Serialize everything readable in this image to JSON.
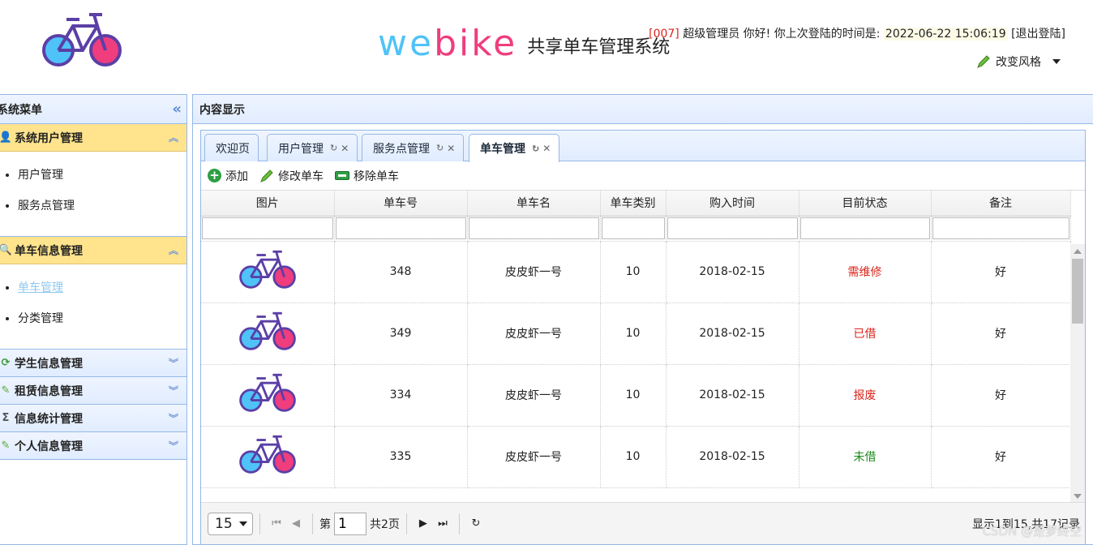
{
  "header": {
    "brand_we": "we",
    "brand_bike": "bike",
    "brand_sub": "共享单车管理系统",
    "user_id": "[007]",
    "user_text": " 超级管理员 你好! 你上次登陆的时间是: ",
    "last_login": "2022-06-22 15:06:19",
    "logout": "[退出登陆]",
    "change_style": "改变风格"
  },
  "sidebar": {
    "title": "系统菜单",
    "groups": [
      {
        "label": "系统用户管理",
        "icon": "user-icon",
        "items": [
          "用户管理",
          "服务点管理"
        ]
      },
      {
        "label": "单车信息管理",
        "icon": "search-icon",
        "items": [
          "单车管理",
          "分类管理"
        ]
      },
      {
        "label": "学生信息管理",
        "icon": "refresh-icon"
      },
      {
        "label": "租赁信息管理",
        "icon": "pencil-icon"
      },
      {
        "label": "信息统计管理",
        "icon": "sigma-icon"
      },
      {
        "label": "个人信息管理",
        "icon": "pencil-icon"
      }
    ]
  },
  "main": {
    "title": "内容显示",
    "tabs": [
      "欢迎页",
      "用户管理",
      "服务点管理",
      "单车管理"
    ],
    "toolbar": {
      "add": "添加",
      "edit": "修改单车",
      "remove": "移除单车"
    },
    "columns": [
      "图片",
      "单车号",
      "单车名",
      "单车类别",
      "购入时间",
      "目前状态",
      "备注"
    ],
    "rows": [
      {
        "no": "348",
        "name": "皮皮虾一号",
        "cat": "10",
        "date": "2018-02-15",
        "status": "需维修",
        "status_color": "#d9261c",
        "note": "好"
      },
      {
        "no": "349",
        "name": "皮皮虾一号",
        "cat": "10",
        "date": "2018-02-15",
        "status": "已借",
        "status_color": "#d9261c",
        "note": "好"
      },
      {
        "no": "334",
        "name": "皮皮虾一号",
        "cat": "10",
        "date": "2018-02-15",
        "status": "报废",
        "status_color": "#d9261c",
        "note": "好"
      },
      {
        "no": "335",
        "name": "皮皮虾一号",
        "cat": "10",
        "date": "2018-02-15",
        "status": "未借",
        "status_color": "#1a8a1a",
        "note": "好"
      }
    ]
  },
  "pager": {
    "page_size": "15",
    "page_prefix": "第",
    "page": "1",
    "page_total": "共2页",
    "info": "显示1到15,共17记录"
  },
  "watermark": "CSDN @是梦终空",
  "colors": {
    "bike_frame": "#5b3fa6",
    "bike_front": "#4fc3f7",
    "bike_rear": "#ef3d7e"
  }
}
